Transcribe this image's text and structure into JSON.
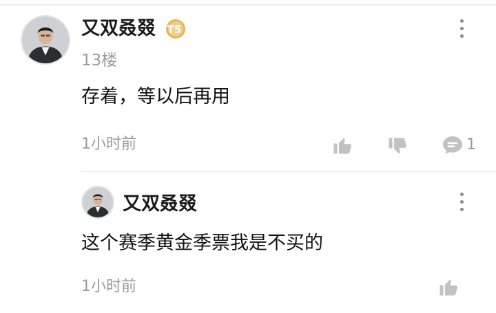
{
  "comment": {
    "username": "又双叒叕",
    "badge_text": "T5",
    "badge_color": "#e8b45a",
    "floor": "13楼",
    "content": "存着，等以后再用",
    "time": "1小时前",
    "comment_count": "1",
    "icons": [
      "like-icon",
      "dislike-icon",
      "comment-icon",
      "more-icon"
    ]
  },
  "reply": {
    "username": "又双叒叕",
    "content": "这个赛季黄金季票我是不买的",
    "time": "1小时前",
    "icons": [
      "like-icon",
      "more-icon"
    ]
  }
}
